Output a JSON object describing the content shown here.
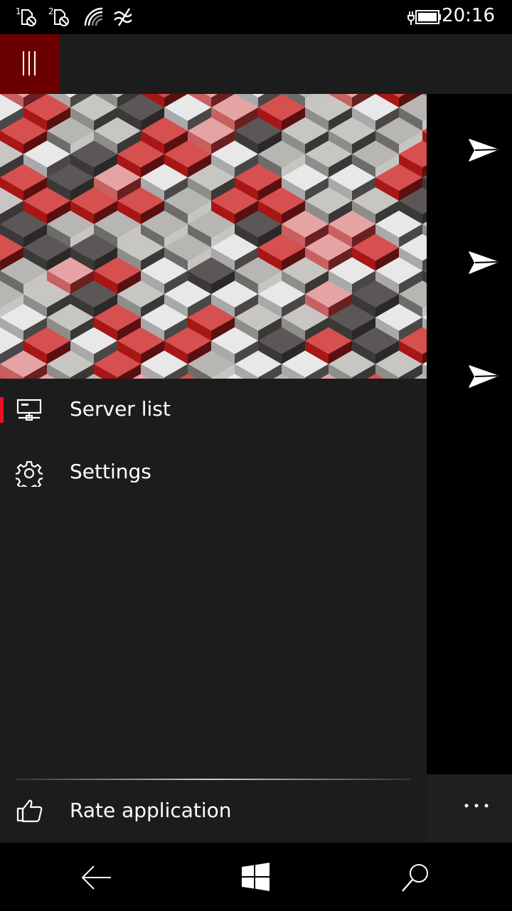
{
  "status_bar": {
    "time": "20:16",
    "sim1_label": "1",
    "sim2_label": "2",
    "icons": [
      "sim1-no-service-icon",
      "sim2-no-service-icon",
      "wifi-icon",
      "data-connection-icon",
      "battery-charging-icon"
    ]
  },
  "app_bar": {
    "menu_icon": "hamburger-icon",
    "accent_color": "#6b0000"
  },
  "drawer": {
    "header_image": "red-grey-isometric-cubes-pattern",
    "items": [
      {
        "label": "Server list",
        "icon": "server-icon",
        "selected": true
      },
      {
        "label": "Settings",
        "icon": "gear-icon",
        "selected": false
      }
    ],
    "footer_item": {
      "label": "Rate application",
      "icon": "thumbs-up-icon"
    }
  },
  "background": {
    "send_buttons_count": 3,
    "send_icon": "send-icon",
    "more_icon": "more-icon"
  },
  "nav_bar": {
    "icons": [
      "back-icon",
      "windows-icon",
      "search-icon"
    ]
  },
  "colors": {
    "accent": "#e81123",
    "drawer_bg": "#1c1c1c",
    "app_bar_bg": "#1c1c1c",
    "menu_button_bg": "#6b0000"
  }
}
